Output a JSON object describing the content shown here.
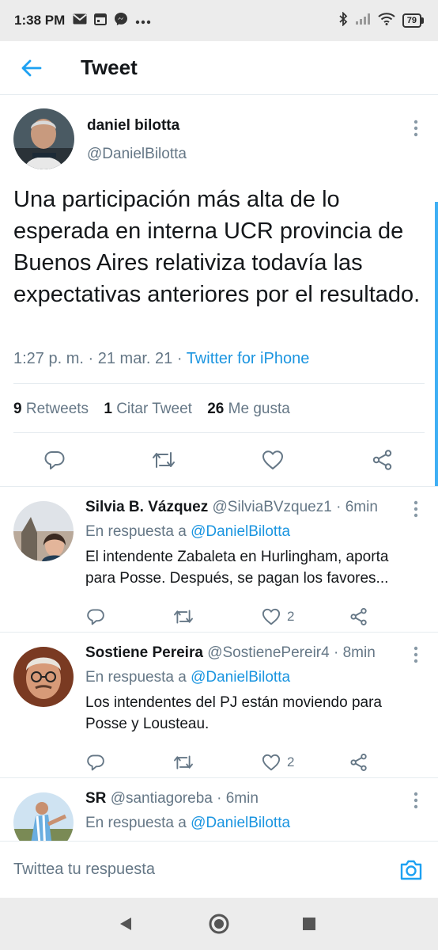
{
  "status_bar": {
    "time": "1:38 PM",
    "battery": "79",
    "icons": [
      "gmail-icon",
      "calendar-icon",
      "messenger-icon",
      "more-dots-icon",
      "bluetooth-icon",
      "signal-icon",
      "wifi-icon",
      "battery-icon"
    ]
  },
  "header": {
    "title": "Tweet",
    "back_icon": "arrow-left-icon"
  },
  "main_tweet": {
    "name": "daniel bilotta",
    "handle": "@DanielBilotta",
    "text": "Una participación más alta de lo esperada en interna UCR provincia de Buenos Aires relativiza todavía las expectativas anteriores por el resultado.",
    "time": "1:27 p. m.",
    "date": "21 mar. 21",
    "separator": "·",
    "source": "Twitter for iPhone",
    "stats": {
      "retweets_count": "9",
      "retweets_label": "Retweets",
      "quotes_count": "1",
      "quotes_label": "Citar Tweet",
      "likes_count": "26",
      "likes_label": "Me gusta"
    }
  },
  "replies": [
    {
      "name": "Silvia B. Vázquez",
      "handle": "@SilviaBVzquez1",
      "time": "· 6min",
      "reply_to_label": "En respuesta a",
      "reply_to_handle": "@DanielBilotta",
      "text_line1": "El intendente Zabaleta en Hurlingham, aporta",
      "text_line2": "para Posse. Después, se pagan los favores...",
      "likes": "2"
    },
    {
      "name": "Sostiene Pereira",
      "handle": "@SostienePereir4",
      "time": "· 8min",
      "reply_to_label": "En respuesta a",
      "reply_to_handle": "@DanielBilotta",
      "text_line1": "Los intendentes del PJ están moviendo para",
      "text_line2": "Posse y Lousteau.",
      "likes": "2"
    },
    {
      "name": "SR",
      "handle": "@santiagoreba",
      "time": "· 6min",
      "reply_to_label": "En respuesta a",
      "reply_to_handle": "@DanielBilotta",
      "text_line1": "",
      "text_line2": "",
      "likes": ""
    }
  ],
  "compose": {
    "placeholder": "Twittea tu respuesta"
  },
  "colors": {
    "accent": "#1da1f2",
    "link": "#1b95e0",
    "secondary_text": "#657786",
    "divider": "#e6ecf0",
    "system_bar": "#ececec"
  }
}
